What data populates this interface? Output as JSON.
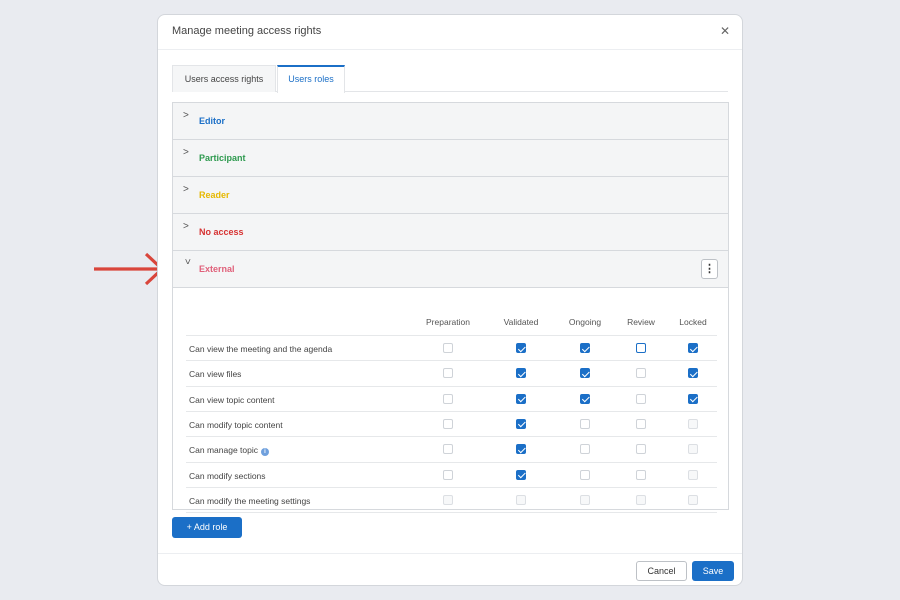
{
  "modal": {
    "title": "Manage meeting access rights",
    "close": "✕"
  },
  "tabs": [
    {
      "label": "Users access rights",
      "active": false
    },
    {
      "label": "Users roles",
      "active": true
    }
  ],
  "roles": [
    {
      "name": "Editor",
      "color": "#1b6fc7",
      "expanded": false
    },
    {
      "name": "Participant",
      "color": "#2e9a4f",
      "expanded": false
    },
    {
      "name": "Reader",
      "color": "#e6b800",
      "expanded": false
    },
    {
      "name": "No access",
      "color": "#d63232",
      "expanded": false
    },
    {
      "name": "External",
      "color": "#e0607a",
      "expanded": true
    }
  ],
  "kebab_icon": "⋮",
  "permissions": {
    "columns": [
      "Preparation",
      "Validated",
      "Ongoing",
      "Review",
      "Locked"
    ],
    "rows": [
      {
        "label": "Can view the meeting and the agenda",
        "info": false,
        "states": [
          "unchecked",
          "checked",
          "checked",
          "outline",
          "checked"
        ]
      },
      {
        "label": "Can view files",
        "info": false,
        "states": [
          "unchecked",
          "checked",
          "checked",
          "unchecked",
          "checked"
        ]
      },
      {
        "label": "Can view topic content",
        "info": false,
        "states": [
          "unchecked",
          "checked",
          "checked",
          "unchecked",
          "checked"
        ]
      },
      {
        "label": "Can modify topic content",
        "info": false,
        "states": [
          "unchecked",
          "checked",
          "unchecked",
          "unchecked",
          "disabled"
        ]
      },
      {
        "label": "Can manage topic",
        "info": true,
        "states": [
          "unchecked",
          "checked",
          "unchecked",
          "unchecked",
          "disabled"
        ]
      },
      {
        "label": "Can modify sections",
        "info": false,
        "states": [
          "unchecked",
          "checked",
          "unchecked",
          "unchecked",
          "disabled"
        ]
      },
      {
        "label": "Can modify the meeting settings",
        "info": false,
        "states": [
          "disabled",
          "disabled",
          "disabled",
          "disabled",
          "disabled"
        ]
      }
    ]
  },
  "buttons": {
    "add_role": "+ Add role",
    "cancel": "Cancel",
    "save": "Save"
  },
  "colors": {
    "accent": "#1b6fc7",
    "arrow": "#d9453b"
  }
}
